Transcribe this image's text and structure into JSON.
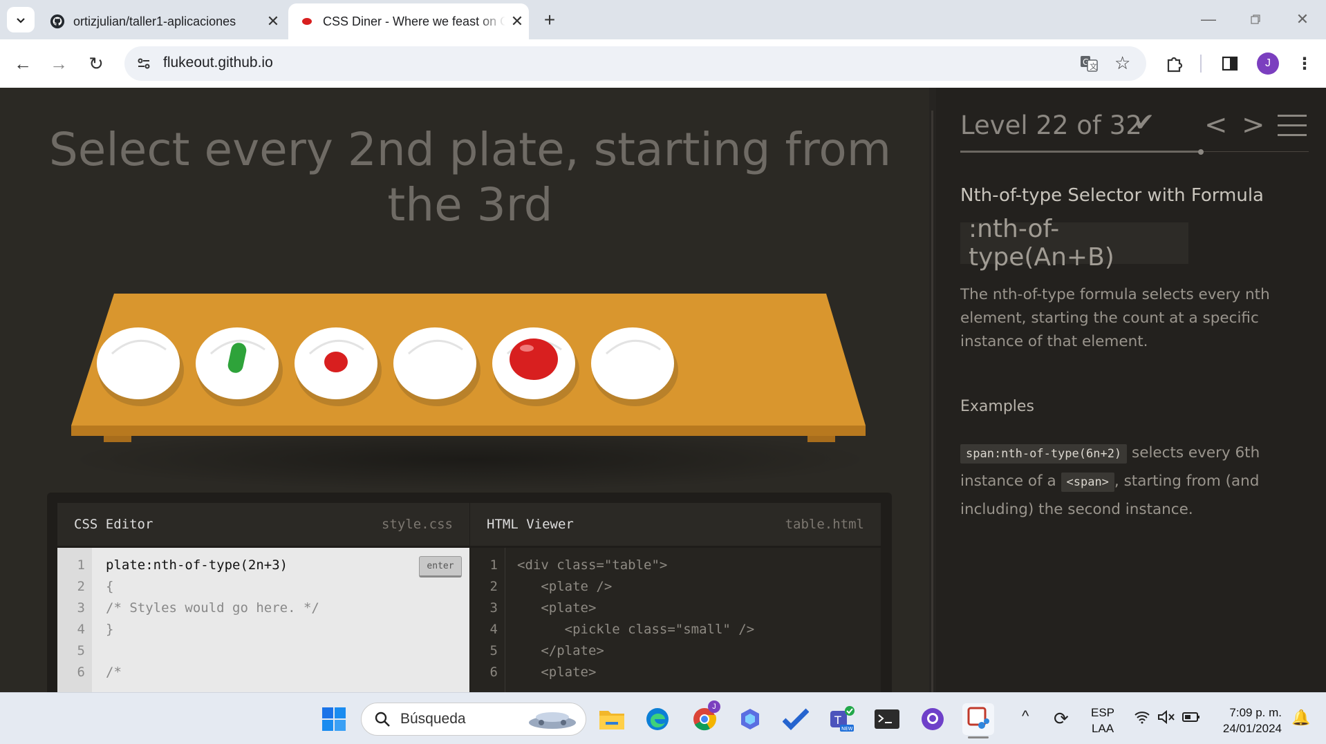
{
  "browser": {
    "tabs": [
      {
        "title": "ortizjulian/taller1-aplicaciones",
        "active": false,
        "icon": "github-icon"
      },
      {
        "title": "CSS Diner - Where we feast on CSS Selectors!",
        "active": true,
        "icon": "red-dot-icon"
      }
    ],
    "url": "flukeout.github.io",
    "profile_initial": "J"
  },
  "game": {
    "instruction": "Select every 2nd plate, starting from the 3rd",
    "plates": [
      {
        "item": "none"
      },
      {
        "item": "pickle"
      },
      {
        "item": "small-apple"
      },
      {
        "item": "none"
      },
      {
        "item": "apple"
      },
      {
        "item": "none"
      }
    ],
    "css_editor": {
      "title": "CSS Editor",
      "filename": "style.css",
      "enter_label": "enter",
      "input_value": "plate:nth-of-type(2n+3)",
      "lines": [
        {
          "n": "1",
          "text": "plate:nth-of-type(2n+3)"
        },
        {
          "n": "2",
          "text": "{"
        },
        {
          "n": "3",
          "text": "/* Styles would go here. */"
        },
        {
          "n": "4",
          "text": "}"
        },
        {
          "n": "5",
          "text": ""
        },
        {
          "n": "6",
          "text": "/*"
        }
      ]
    },
    "html_viewer": {
      "title": "HTML Viewer",
      "filename": "table.html",
      "lines": [
        {
          "n": "1",
          "text": "<div class=\"table\">"
        },
        {
          "n": "2",
          "text": "   <plate />"
        },
        {
          "n": "3",
          "text": "   <plate>"
        },
        {
          "n": "4",
          "text": "      <pickle class=\"small\" />"
        },
        {
          "n": "5",
          "text": "   </plate>"
        },
        {
          "n": "6",
          "text": "   <plate>"
        }
      ]
    }
  },
  "sidebar": {
    "level_label": "Level 22 of 32",
    "level_completed": true,
    "title": "Nth-of-type Selector with Formula",
    "selector": ":nth-of-type(An+B)",
    "description": "The nth-of-type formula selects every nth element, starting the count at a specific instance of that element.",
    "examples_heading": "Examples",
    "example": {
      "code": "span:nth-of-type(6n+2)",
      "text1": "selects every 6th instance of a",
      "code2": "<span>",
      "text2": ", starting from (and including) the second instance."
    }
  },
  "taskbar": {
    "search_placeholder": "Búsqueda",
    "lang": "ESP",
    "lang_sub": "LAA",
    "time": "7:09 p. m.",
    "date": "24/01/2024"
  },
  "colors": {
    "table": "#d9962e",
    "table_edge": "#c4862a",
    "plate": "#ffffff",
    "apple": "#d81f1f",
    "pickle": "#2ea33a",
    "background": "#2b2924"
  }
}
